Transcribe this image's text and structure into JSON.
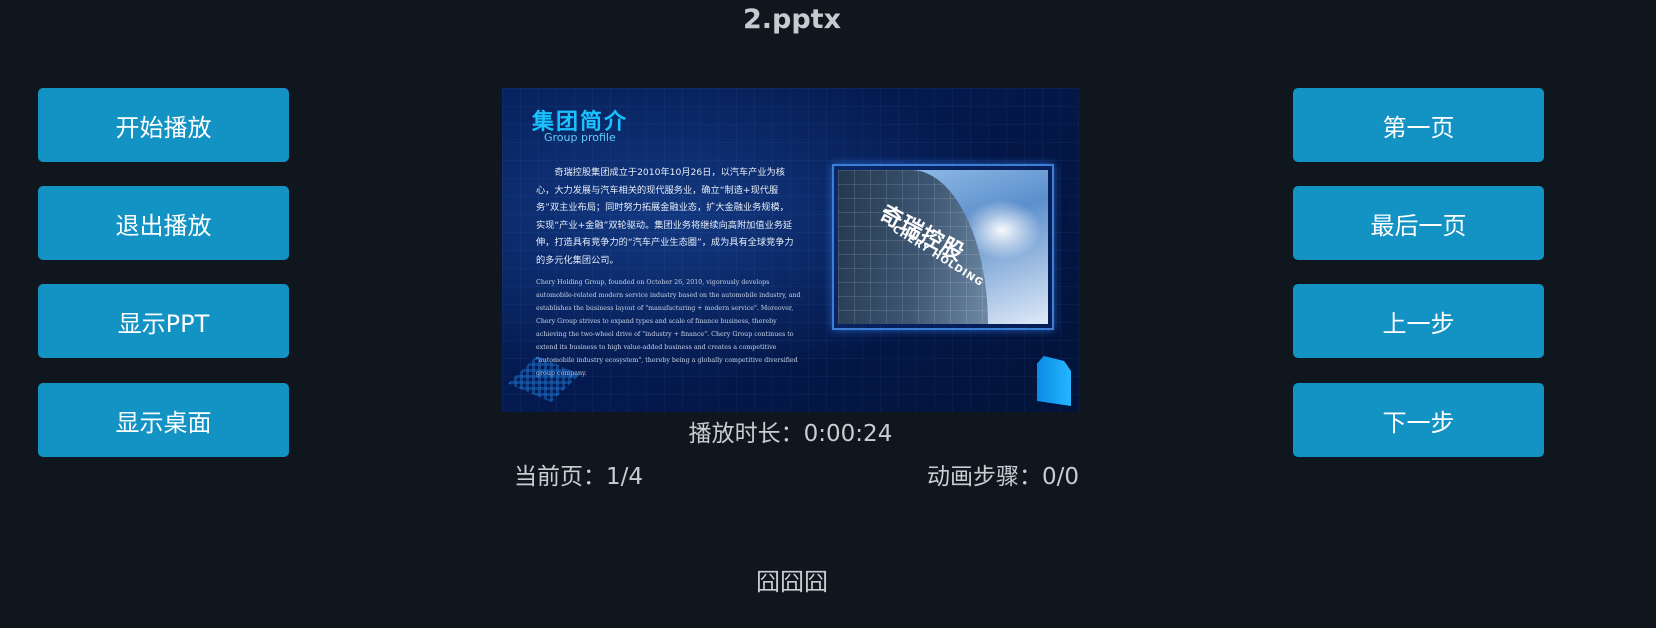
{
  "window": {
    "title": "2.pptx"
  },
  "left_buttons": [
    {
      "label": "开始播放"
    },
    {
      "label": "退出播放"
    },
    {
      "label": "显示PPT"
    },
    {
      "label": "显示桌面"
    }
  ],
  "right_buttons": [
    {
      "label": "第一页"
    },
    {
      "label": "最后一页"
    },
    {
      "label": "上一步"
    },
    {
      "label": "下一步"
    }
  ],
  "slide": {
    "heading": "集团简介",
    "subheading": "Group profile",
    "body_cn": "奇瑞控股集团成立于2010年10月26日，以汽车产业为核心，大力发展与汽车相关的现代服务业，确立“制造+现代服务”双主业布局；同时努力拓展金融业态，扩大金融业务规模，实现“产业+金融”双轮驱动。集团业务将继续向高附加值业务延伸，打造具有竞争力的“汽车产业生态圈”，成为具有全球竞争力的多元化集团公司。",
    "body_en": "Chery Holding Group, founded on October 26, 2010, vigorously develops automobile-related modern service industry based on the automobile industry, and establishes the business layout of \"manufacturing + modern service\". Moreover, Chery Group strives to expand types and scale of finance business, thereby achieving the two-wheel drive of \"industry + finance\". Chery Group continues to extend its business to high value-added business and creates a competitive \"automobile industry ecosystem\", thereby being a globally competitive diversified group company.",
    "photo_logo_cn": "奇瑞控股",
    "photo_logo_en": "CHERY HOLDING"
  },
  "status": {
    "duration": "播放时长：0:00:24",
    "current_page": "当前页：1/4",
    "animation_steps": "动画步骤：0/0"
  },
  "footer": {
    "glyphs": "囧囧囧"
  }
}
